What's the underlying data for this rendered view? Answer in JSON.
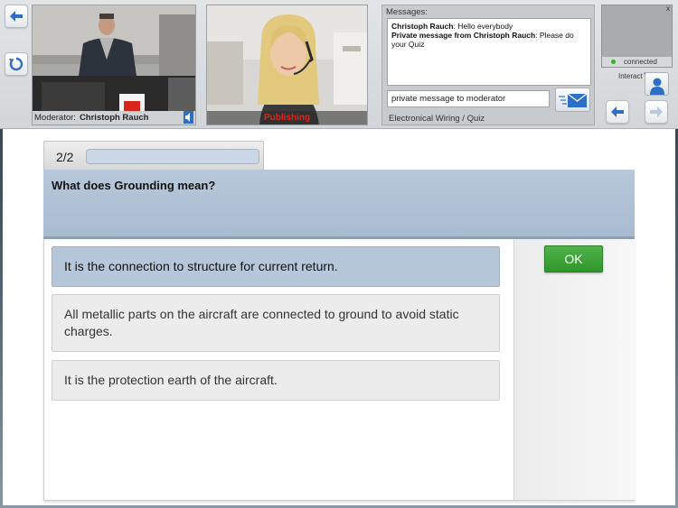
{
  "header": {
    "moderator_label": "Moderator:",
    "moderator_name": "Christoph Rauch",
    "publishing_label": "Publishing",
    "messages_label": "Messages:",
    "messages": [
      {
        "sender": "Christoph Rauch",
        "separator": ": ",
        "text": "Hello everybody"
      },
      {
        "sender": "Private message from Christoph Rauch",
        "separator": ": ",
        "text": "Please do your Quiz"
      }
    ],
    "message_input_value": "private message to moderator",
    "course_label": "Electronical Wiring / Quiz",
    "status": "connected",
    "status_color": "#2bb52b",
    "close_glyph": "x",
    "interact_label": "Interact",
    "interact_caret": "▾",
    "accent_color": "#2d6fc6"
  },
  "quiz": {
    "progress_counter": "2/2",
    "progress_fraction": 1.0,
    "question": "What does Grounding mean?",
    "answers": [
      {
        "text": "It is the connection to structure for current return.",
        "selected": true
      },
      {
        "text": "All metallic parts on the aircraft are connected to ground to avoid static charges.",
        "selected": false
      },
      {
        "text": "It is the protection earth of the aircraft.",
        "selected": false
      }
    ],
    "ok_label": "OK",
    "ok_color": "#3aa535"
  },
  "icons": [
    "arrow-left-icon",
    "refresh-icon",
    "speaker-icon",
    "envelope-icon",
    "user-icon",
    "arrow-right-icon"
  ]
}
